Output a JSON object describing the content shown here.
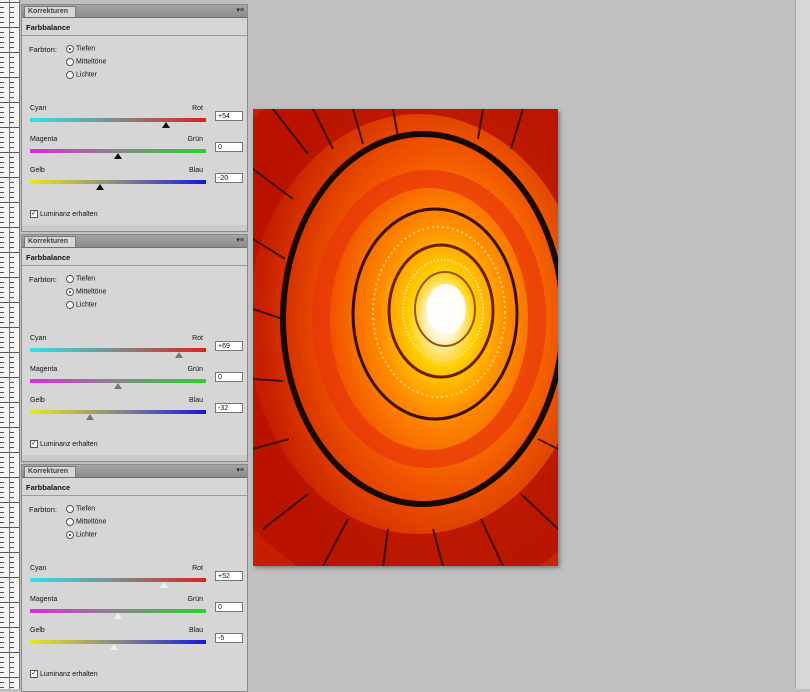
{
  "panels": [
    {
      "tab_label": "Korrekturen",
      "menu_icon": "panel-menu-icon",
      "title": "Farbbalance",
      "farbton_label": "Farbton:",
      "tones": [
        "Tiefen",
        "Mitteltöne",
        "Lichter"
      ],
      "selected_tone": "Tiefen",
      "sliders": [
        {
          "left": "Cyan",
          "right": "Rot",
          "value": "+54",
          "fraction": 0.77
        },
        {
          "left": "Magenta",
          "right": "Grün",
          "value": "0",
          "fraction": 0.5
        },
        {
          "left": "Gelb",
          "right": "Blau",
          "value": "-20",
          "fraction": 0.4
        }
      ],
      "preserve_label": "Luminanz erhalten",
      "preserve_checked": true,
      "thumb_style": "dark"
    },
    {
      "tab_label": "Korrekturen",
      "menu_icon": "panel-menu-icon",
      "title": "Farbbalance",
      "farbton_label": "Farbton:",
      "tones": [
        "Tiefen",
        "Mitteltöne",
        "Lichter"
      ],
      "selected_tone": "Mitteltöne",
      "sliders": [
        {
          "left": "Cyan",
          "right": "Rot",
          "value": "+69",
          "fraction": 0.845
        },
        {
          "left": "Magenta",
          "right": "Grün",
          "value": "0",
          "fraction": 0.5
        },
        {
          "left": "Gelb",
          "right": "Blau",
          "value": "-32",
          "fraction": 0.34
        }
      ],
      "preserve_label": "Luminanz erhalten",
      "preserve_checked": true,
      "thumb_style": "mid"
    },
    {
      "tab_label": "Korrekturen",
      "menu_icon": "panel-menu-icon",
      "title": "Farbbalance",
      "farbton_label": "Farbton:",
      "tones": [
        "Tiefen",
        "Mitteltöne",
        "Lichter"
      ],
      "selected_tone": "Lichter",
      "sliders": [
        {
          "left": "Cyan",
          "right": "Rot",
          "value": "+52",
          "fraction": 0.76
        },
        {
          "left": "Magenta",
          "right": "Grün",
          "value": "0",
          "fraction": 0.5
        },
        {
          "left": "Gelb",
          "right": "Blau",
          "value": "-5",
          "fraction": 0.475
        }
      ],
      "preserve_label": "Luminanz erhalten",
      "preserve_checked": true,
      "thumb_style": "light"
    }
  ],
  "canvas": {
    "image_icon": "spiral-staircase-photo",
    "colors": {
      "background": "#c0c0c0",
      "photo_red": "#d81800",
      "photo_orange": "#ff7a00",
      "photo_yellow": "#ffe800"
    }
  }
}
